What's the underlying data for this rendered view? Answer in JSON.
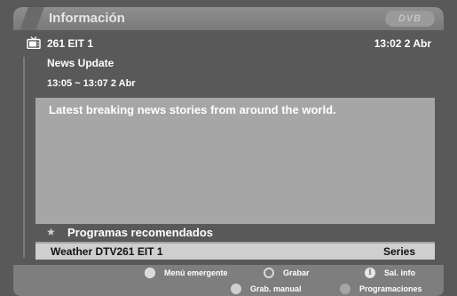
{
  "window": {
    "title": "Información",
    "logo_text": "DVB"
  },
  "channel": {
    "icon": "tv-icon",
    "name": "261 EIT 1",
    "clock": "13:02 2 Abr"
  },
  "program": {
    "title": "News Update",
    "time": "13:05 ~ 13:07 2 Abr",
    "description": "Latest breaking news stories from around the world."
  },
  "recommended": {
    "icon": "star-icon",
    "label": "Programas recomendados",
    "items": [
      {
        "name": "Weather DTV261 EIT 1",
        "genre": "Series"
      }
    ]
  },
  "footer": {
    "buttons": [
      {
        "icon": "green-button",
        "label": "Menú emergente"
      },
      {
        "icon": "yellow-button",
        "label": "Grabar"
      },
      {
        "icon": "info-button",
        "label": "Sal. info"
      },
      {
        "icon": "red-button",
        "label": "Grab. manual"
      },
      {
        "icon": "blue-button",
        "label": "Programaciones"
      }
    ]
  }
}
